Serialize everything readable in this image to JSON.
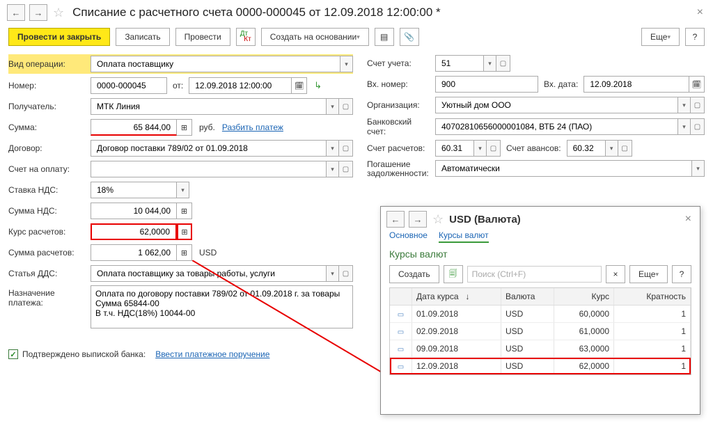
{
  "main": {
    "title": "Списание с расчетного счета 0000-000045 от 12.09.2018 12:00:00 *",
    "toolbar": {
      "commit": "Провести и закрыть",
      "save": "Записать",
      "commit_only": "Провести",
      "create_based": "Создать на основании",
      "more": "Еще"
    },
    "labels": {
      "op_type": "Вид операции:",
      "number": "Номер:",
      "from": "от:",
      "recipient": "Получатель:",
      "amount": "Сумма:",
      "currency": "руб.",
      "split": "Разбить платеж",
      "contract": "Договор:",
      "invoice": "Счет на оплату:",
      "vat_rate": "Ставка НДС:",
      "vat_sum": "Сумма НДС:",
      "rate": "Курс расчетов:",
      "calc_sum": "Сумма расчетов:",
      "calc_cur": "USD",
      "dds": "Статья ДДС:",
      "purpose": "Назначение платежа:",
      "account": "Счет учета:",
      "in_number": "Вх. номер:",
      "in_date": "Вх. дата:",
      "org": "Организация:",
      "bank_acc": "Банковский счет:",
      "calc_acc": "Счет расчетов:",
      "adv_acc": "Счет авансов:",
      "debt": "Погашение задолженности:",
      "confirmed": "Подтверждено выпиской банка:",
      "enter_order": "Ввести платежное поручение"
    },
    "values": {
      "op_type": "Оплата поставщику",
      "number": "0000-000045",
      "date": "12.09.2018 12:00:00",
      "recipient": "МТК Линия",
      "amount": "65 844,00",
      "contract": "Договор поставки 789/02 от 01.09.2018",
      "vat_rate": "18%",
      "vat_sum": "10 044,00",
      "rate": "62,0000",
      "calc_sum": "1 062,00",
      "dds": "Оплата поставщику за товары работы, услуги",
      "purpose": "Оплата по договору поставки 789/02 от 01.09.2018 г. за товары\nСумма 65844-00\nВ т.ч. НДС(18%) 10044-00",
      "account": "51",
      "in_number": "900",
      "in_date": "12.09.2018",
      "org": "Уютный дом ООО",
      "bank_acc": "40702810656000001084, ВТБ 24 (ПАО)",
      "calc_acc": "60.31",
      "adv_acc": "60.32",
      "debt": "Автоматически"
    }
  },
  "popup": {
    "title": "USD (Валюта)",
    "tabs": {
      "main": "Основное",
      "rates": "Курсы валют"
    },
    "section": "Курсы валют",
    "create": "Создать",
    "search_ph": "Поиск (Ctrl+F)",
    "more": "Еще",
    "cols": {
      "date": "Дата курса",
      "cur": "Валюта",
      "rate": "Курс",
      "mult": "Кратность"
    },
    "rows": [
      {
        "date": "01.09.2018",
        "cur": "USD",
        "rate": "60,0000",
        "mult": "1"
      },
      {
        "date": "02.09.2018",
        "cur": "USD",
        "rate": "61,0000",
        "mult": "1"
      },
      {
        "date": "09.09.2018",
        "cur": "USD",
        "rate": "63,0000",
        "mult": "1"
      },
      {
        "date": "12.09.2018",
        "cur": "USD",
        "rate": "62,0000",
        "mult": "1"
      }
    ]
  }
}
